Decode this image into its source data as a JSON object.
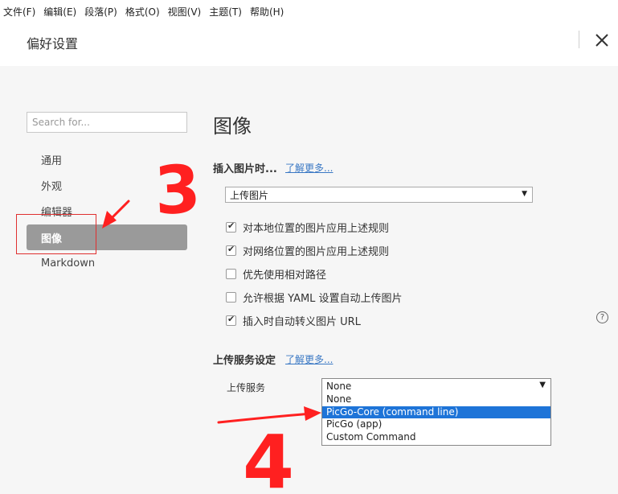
{
  "menubar": {
    "items": [
      "文件(F)",
      "编辑(E)",
      "段落(P)",
      "格式(O)",
      "视图(V)",
      "主题(T)",
      "帮助(H)"
    ]
  },
  "window": {
    "title": "偏好设置",
    "close_icon": "close-icon"
  },
  "sidebar": {
    "search_placeholder": "Search for...",
    "items": [
      {
        "label": "通用",
        "active": false
      },
      {
        "label": "外观",
        "active": false
      },
      {
        "label": "编辑器",
        "active": false
      },
      {
        "label": "图像",
        "active": true
      },
      {
        "label": "Markdown",
        "active": false
      }
    ]
  },
  "main": {
    "heading": "图像",
    "insert_section": {
      "label": "插入图片时...",
      "learn_more": "了解更多...",
      "select_value": "上传图片"
    },
    "checkboxes": [
      {
        "label": "对本地位置的图片应用上述规则",
        "checked": true
      },
      {
        "label": "对网络位置的图片应用上述规则",
        "checked": true
      },
      {
        "label": "优先使用相对路径",
        "checked": false
      },
      {
        "label": "允许根据 YAML 设置自动上传图片",
        "checked": false
      },
      {
        "label": "插入时自动转义图片 URL",
        "checked": true
      }
    ],
    "help_icon": "question-circle-icon",
    "help_glyph": "?",
    "upload_section": {
      "label": "上传服务设定",
      "learn_more": "了解更多...",
      "service_label": "上传服务",
      "select_value": "None",
      "options": [
        {
          "label": "None",
          "highlighted": false
        },
        {
          "label": "PicGo-Core (command line)",
          "highlighted": true
        },
        {
          "label": "PicGo (app)",
          "highlighted": false
        },
        {
          "label": "Custom Command",
          "highlighted": false
        }
      ]
    }
  },
  "annotations": {
    "number_3": "3",
    "number_4": "4",
    "color": "#ff2020"
  }
}
